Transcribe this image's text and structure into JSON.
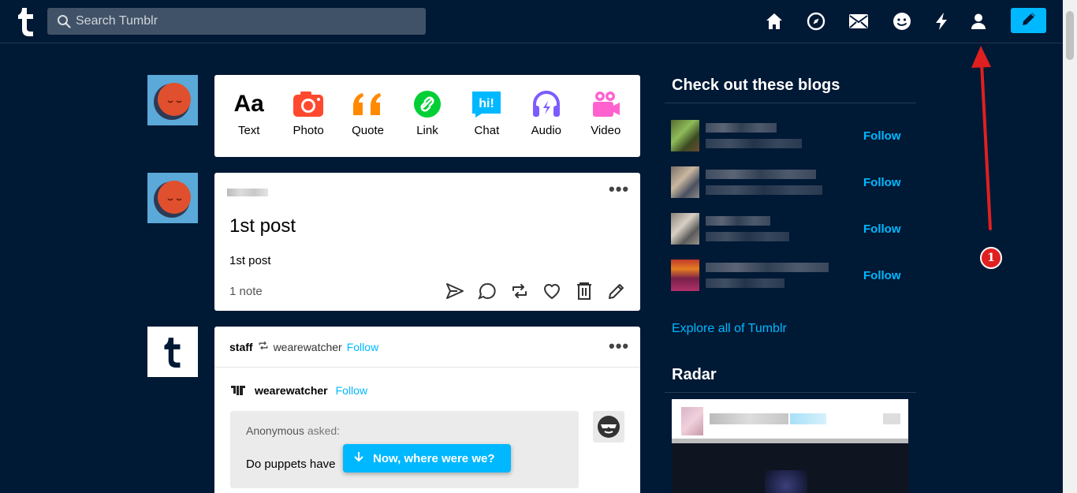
{
  "header": {
    "search_placeholder": "Search Tumblr",
    "nav_icons": [
      "home-icon",
      "explore-icon",
      "inbox-icon",
      "messaging-icon",
      "activity-icon",
      "account-icon",
      "compose-icon"
    ],
    "accent_color": "#00b8ff",
    "background_color": "#001935"
  },
  "composer": {
    "types": [
      {
        "label": "Text",
        "icon": "text-icon",
        "color": "#000000"
      },
      {
        "label": "Photo",
        "icon": "camera-icon",
        "color": "#ff492f"
      },
      {
        "label": "Quote",
        "icon": "quote-icon",
        "color": "#ff8a00"
      },
      {
        "label": "Link",
        "icon": "link-icon",
        "color": "#00cf35"
      },
      {
        "label": "Chat",
        "icon": "chat-icon",
        "color": "#00b8ff"
      },
      {
        "label": "Audio",
        "icon": "headphones-icon",
        "color": "#7c5cff"
      },
      {
        "label": "Video",
        "icon": "video-icon",
        "color": "#ff62ce"
      }
    ]
  },
  "post1": {
    "title": "1st post",
    "body": "1st post",
    "notes": "1 note",
    "actions": [
      "share-icon",
      "reply-icon",
      "reblog-icon",
      "like-icon",
      "delete-icon",
      "edit-icon"
    ]
  },
  "post2": {
    "author": "staff",
    "reblogged_from": "wearewatcher",
    "follow_label": "Follow",
    "source_blog": "wearewatcher",
    "source_follow_label": "Follow",
    "asker": "Anonymous",
    "asked_label": "asked:",
    "question": "Do puppets have"
  },
  "toast": {
    "label": "Now, where were we?"
  },
  "sidebar": {
    "blogs_heading": "Check out these blogs",
    "follow_label": "Follow",
    "explore_label": "Explore all of Tumblr",
    "radar_heading": "Radar"
  },
  "annotation": {
    "badge": "1",
    "color": "#e02020"
  }
}
